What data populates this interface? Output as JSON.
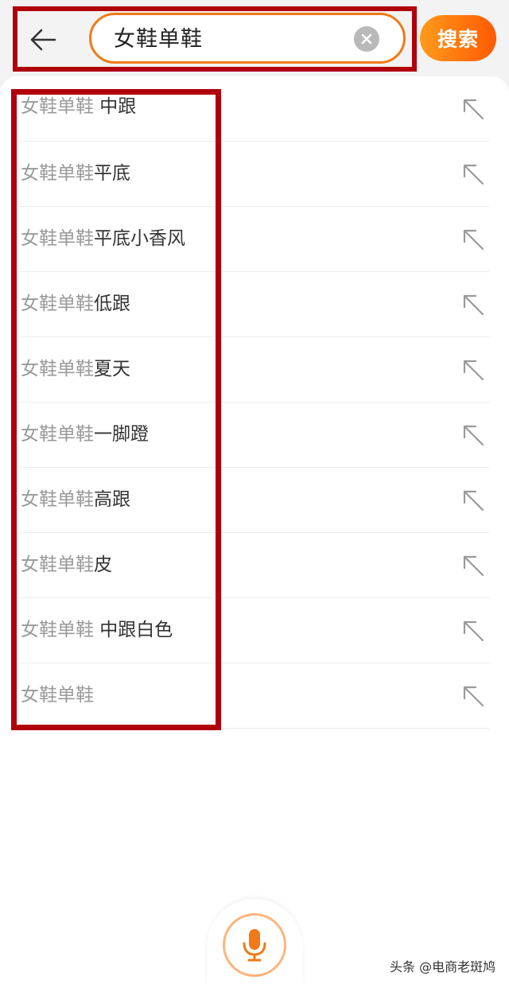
{
  "search": {
    "query": "女鞋单鞋",
    "button_label": "搜索"
  },
  "suggestions": [
    {
      "prefix": "女鞋单鞋",
      "suffix": " 中跟"
    },
    {
      "prefix": "女鞋单鞋",
      "suffix": "平底"
    },
    {
      "prefix": "女鞋单鞋",
      "suffix": "平底小香风"
    },
    {
      "prefix": "女鞋单鞋",
      "suffix": "低跟"
    },
    {
      "prefix": "女鞋单鞋",
      "suffix": "夏天"
    },
    {
      "prefix": "女鞋单鞋",
      "suffix": "一脚蹬"
    },
    {
      "prefix": "女鞋单鞋",
      "suffix": "高跟"
    },
    {
      "prefix": "女鞋单鞋",
      "suffix": "皮"
    },
    {
      "prefix": "女鞋单鞋",
      "suffix": " 中跟白色"
    },
    {
      "prefix": "女鞋单鞋",
      "suffix": ""
    }
  ],
  "watermark": "头条 @电商老斑鸠",
  "colors": {
    "accent": "#f07a17",
    "highlight_border": "#b0000a",
    "mic": "#f07a17"
  },
  "icons": {
    "back": "back-arrow-icon",
    "clear": "clear-icon",
    "fill_query": "arrow-up-left-icon",
    "mic": "microphone-icon"
  }
}
